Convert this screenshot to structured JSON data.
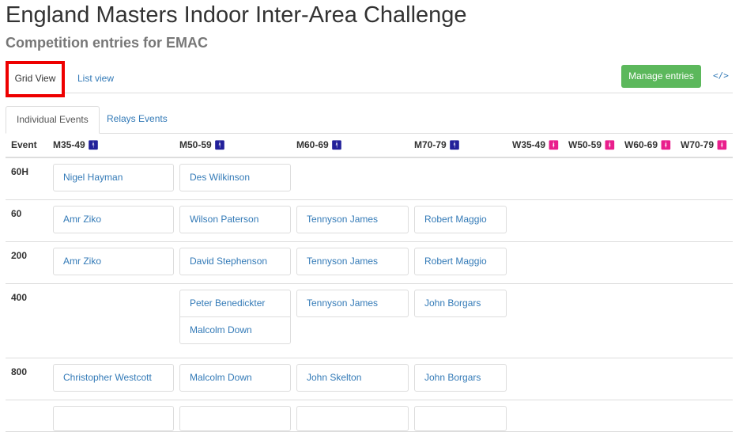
{
  "page": {
    "title": "England Masters Indoor Inter-Area Challenge",
    "subtitle": "Competition entries for EMAC"
  },
  "view_tabs": {
    "grid": "Grid View",
    "list": "List view"
  },
  "toolbar": {
    "manage_label": "Manage entries",
    "code_icon": "</>"
  },
  "event_tabs": {
    "individual": "Individual Events",
    "relays": "Relays Events"
  },
  "colors": {
    "accent_link": "#337ab7",
    "manage_button": "#5cb85c",
    "male_icon": "#22209a",
    "female_icon": "#e91e8c",
    "highlight": "#e00000"
  },
  "table": {
    "headers": [
      "Event",
      "M35-49",
      "M50-59",
      "M60-69",
      "M70-79",
      "W35-49",
      "W50-59",
      "W60-69",
      "W70-79"
    ],
    "gender_icons": [
      "male-icon",
      "male-icon",
      "male-icon",
      "male-icon",
      "female-icon",
      "female-icon",
      "female-icon",
      "female-icon"
    ],
    "rows": [
      {
        "event": "60H",
        "cells": [
          [
            "Nigel Hayman"
          ],
          [
            "Des Wilkinson"
          ],
          [],
          []
        ]
      },
      {
        "event": "60",
        "cells": [
          [
            "Amr Ziko"
          ],
          [
            "Wilson Paterson"
          ],
          [
            "Tennyson James"
          ],
          [
            "Robert Maggio"
          ]
        ]
      },
      {
        "event": "200",
        "cells": [
          [
            "Amr Ziko"
          ],
          [
            "David Stephenson"
          ],
          [
            "Tennyson James"
          ],
          [
            "Robert Maggio"
          ]
        ]
      },
      {
        "event": "400",
        "cells": [
          [],
          [
            "Peter Benedickter",
            "Malcolm Down"
          ],
          [
            "Tennyson James"
          ],
          [
            "John Borgars"
          ]
        ]
      },
      {
        "event": "800",
        "cells": [
          [
            "Christopher Westcott"
          ],
          [
            "Malcolm Down"
          ],
          [
            "John Skelton"
          ],
          [
            "John Borgars"
          ]
        ]
      }
    ]
  }
}
